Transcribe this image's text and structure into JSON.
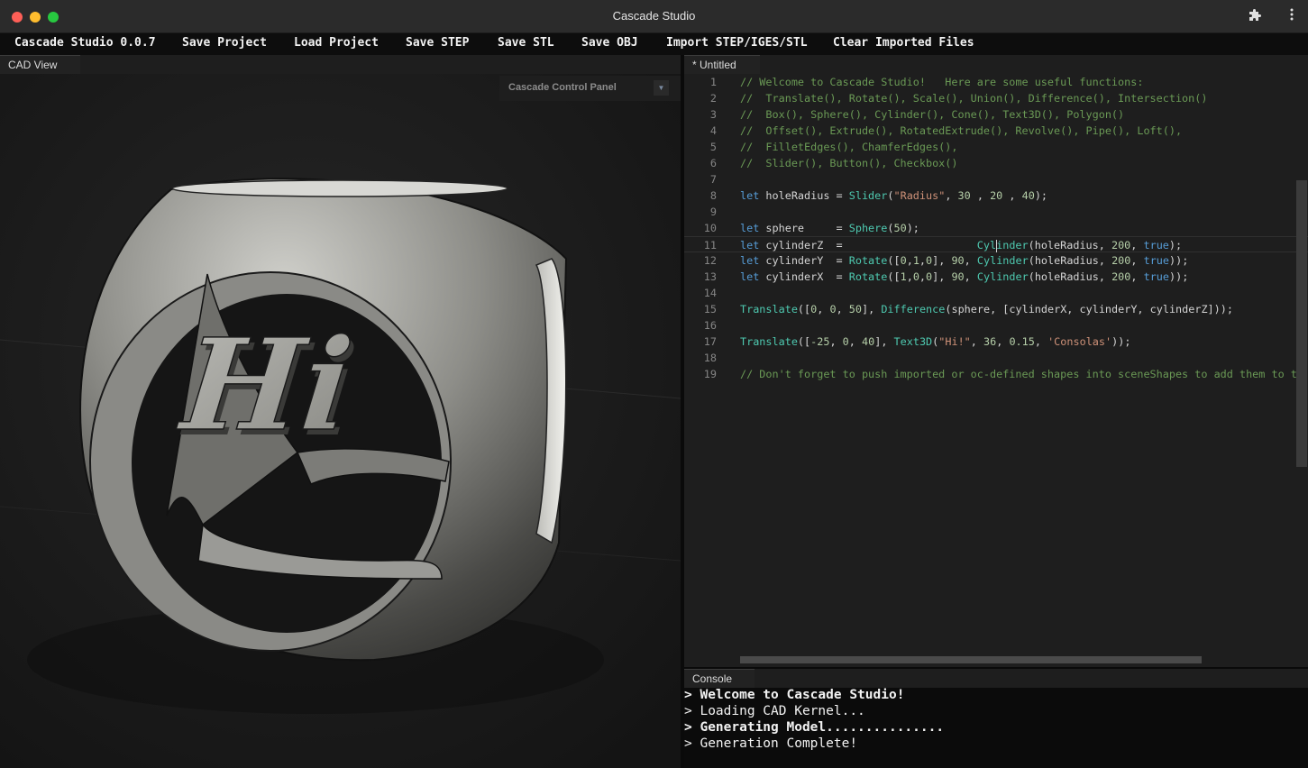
{
  "window": {
    "title": "Cascade Studio"
  },
  "menu": [
    "Cascade Studio 0.0.7",
    "Save Project",
    "Load Project",
    "Save STEP",
    "Save STL",
    "Save OBJ",
    "Import STEP/IGES/STL",
    "Clear Imported Files"
  ],
  "tabs": {
    "cad": "CAD View",
    "editor": "* Untitled",
    "console": "Console"
  },
  "control_panel": {
    "label": "Cascade Control Panel"
  },
  "model_text": "Hi",
  "code_lines": [
    [
      {
        "t": "// Welcome to Cascade Studio!   Here are some useful functions:",
        "c": "com"
      }
    ],
    [
      {
        "t": "//  Translate(), Rotate(), Scale(), Union(), Difference(), Intersection()",
        "c": "com"
      }
    ],
    [
      {
        "t": "//  Box(), Sphere(), Cylinder(), Cone(), Text3D(), Polygon()",
        "c": "com"
      }
    ],
    [
      {
        "t": "//  Offset(), Extrude(), RotatedExtrude(), Revolve(), Pipe(), Loft(),",
        "c": "com"
      }
    ],
    [
      {
        "t": "//  FilletEdges(), ChamferEdges(),",
        "c": "com"
      }
    ],
    [
      {
        "t": "//  Slider(), Button(), Checkbox()",
        "c": "com"
      }
    ],
    [],
    [
      {
        "t": "let",
        "c": "kw"
      },
      {
        "t": " holeRadius = ",
        "c": "id"
      },
      {
        "t": "Slider",
        "c": "fn"
      },
      {
        "t": "(",
        "c": "id"
      },
      {
        "t": "\"Radius\"",
        "c": "str"
      },
      {
        "t": ", ",
        "c": "id"
      },
      {
        "t": "30",
        "c": "num"
      },
      {
        "t": " , ",
        "c": "id"
      },
      {
        "t": "20",
        "c": "num"
      },
      {
        "t": " , ",
        "c": "id"
      },
      {
        "t": "40",
        "c": "num"
      },
      {
        "t": ");",
        "c": "id"
      }
    ],
    [],
    [
      {
        "t": "let",
        "c": "kw"
      },
      {
        "t": " sphere     = ",
        "c": "id"
      },
      {
        "t": "Sphere",
        "c": "fn"
      },
      {
        "t": "(",
        "c": "id"
      },
      {
        "t": "50",
        "c": "num"
      },
      {
        "t": ");",
        "c": "id"
      }
    ],
    [
      {
        "t": "let",
        "c": "kw"
      },
      {
        "t": " cylinderZ  =                     ",
        "c": "id"
      },
      {
        "t": "Cyl",
        "c": "fn"
      },
      {
        "t": "",
        "c": "caret"
      },
      {
        "t": "inder",
        "c": "fn"
      },
      {
        "t": "(holeRadius, ",
        "c": "id"
      },
      {
        "t": "200",
        "c": "num"
      },
      {
        "t": ", ",
        "c": "id"
      },
      {
        "t": "true",
        "c": "kw"
      },
      {
        "t": ");",
        "c": "id"
      }
    ],
    [
      {
        "t": "let",
        "c": "kw"
      },
      {
        "t": " cylinderY  = ",
        "c": "id"
      },
      {
        "t": "Rotate",
        "c": "fn"
      },
      {
        "t": "([",
        "c": "id"
      },
      {
        "t": "0",
        "c": "num"
      },
      {
        "t": ",",
        "c": "id"
      },
      {
        "t": "1",
        "c": "num"
      },
      {
        "t": ",",
        "c": "id"
      },
      {
        "t": "0",
        "c": "num"
      },
      {
        "t": "], ",
        "c": "id"
      },
      {
        "t": "90",
        "c": "num"
      },
      {
        "t": ", ",
        "c": "id"
      },
      {
        "t": "Cylinder",
        "c": "fn"
      },
      {
        "t": "(holeRadius, ",
        "c": "id"
      },
      {
        "t": "200",
        "c": "num"
      },
      {
        "t": ", ",
        "c": "id"
      },
      {
        "t": "true",
        "c": "kw"
      },
      {
        "t": "));",
        "c": "id"
      }
    ],
    [
      {
        "t": "let",
        "c": "kw"
      },
      {
        "t": " cylinderX  = ",
        "c": "id"
      },
      {
        "t": "Rotate",
        "c": "fn"
      },
      {
        "t": "([",
        "c": "id"
      },
      {
        "t": "1",
        "c": "num"
      },
      {
        "t": ",",
        "c": "id"
      },
      {
        "t": "0",
        "c": "num"
      },
      {
        "t": ",",
        "c": "id"
      },
      {
        "t": "0",
        "c": "num"
      },
      {
        "t": "], ",
        "c": "id"
      },
      {
        "t": "90",
        "c": "num"
      },
      {
        "t": ", ",
        "c": "id"
      },
      {
        "t": "Cylinder",
        "c": "fn"
      },
      {
        "t": "(holeRadius, ",
        "c": "id"
      },
      {
        "t": "200",
        "c": "num"
      },
      {
        "t": ", ",
        "c": "id"
      },
      {
        "t": "true",
        "c": "kw"
      },
      {
        "t": "));",
        "c": "id"
      }
    ],
    [],
    [
      {
        "t": "Translate",
        "c": "fn"
      },
      {
        "t": "([",
        "c": "id"
      },
      {
        "t": "0",
        "c": "num"
      },
      {
        "t": ", ",
        "c": "id"
      },
      {
        "t": "0",
        "c": "num"
      },
      {
        "t": ", ",
        "c": "id"
      },
      {
        "t": "50",
        "c": "num"
      },
      {
        "t": "], ",
        "c": "id"
      },
      {
        "t": "Difference",
        "c": "fn"
      },
      {
        "t": "(sphere, [cylinderX, cylinderY, cylinderZ]));",
        "c": "id"
      }
    ],
    [],
    [
      {
        "t": "Translate",
        "c": "fn"
      },
      {
        "t": "([",
        "c": "id"
      },
      {
        "t": "-25",
        "c": "num"
      },
      {
        "t": ", ",
        "c": "id"
      },
      {
        "t": "0",
        "c": "num"
      },
      {
        "t": ", ",
        "c": "id"
      },
      {
        "t": "40",
        "c": "num"
      },
      {
        "t": "], ",
        "c": "id"
      },
      {
        "t": "Text3D",
        "c": "fn"
      },
      {
        "t": "(",
        "c": "id"
      },
      {
        "t": "\"Hi!\"",
        "c": "str"
      },
      {
        "t": ", ",
        "c": "id"
      },
      {
        "t": "36",
        "c": "num"
      },
      {
        "t": ", ",
        "c": "id"
      },
      {
        "t": "0.15",
        "c": "num"
      },
      {
        "t": ", ",
        "c": "id"
      },
      {
        "t": "'Consolas'",
        "c": "str"
      },
      {
        "t": "));",
        "c": "id"
      }
    ],
    [],
    [
      {
        "t": "// Don't forget to push imported or oc-defined shapes into sceneShapes to add them to t",
        "c": "com"
      }
    ]
  ],
  "console_lines": [
    {
      "text": "> Welcome to Cascade Studio!",
      "bold": true
    },
    {
      "text": "> Loading CAD Kernel...",
      "bold": false
    },
    {
      "text": "> Generating Model...............",
      "bold": true
    },
    {
      "text": "> Generation Complete!",
      "bold": false
    }
  ],
  "icons": {
    "extensions": "puzzle-icon",
    "more": "more-vertical-icon",
    "dropdown": "chevron-down-icon"
  }
}
